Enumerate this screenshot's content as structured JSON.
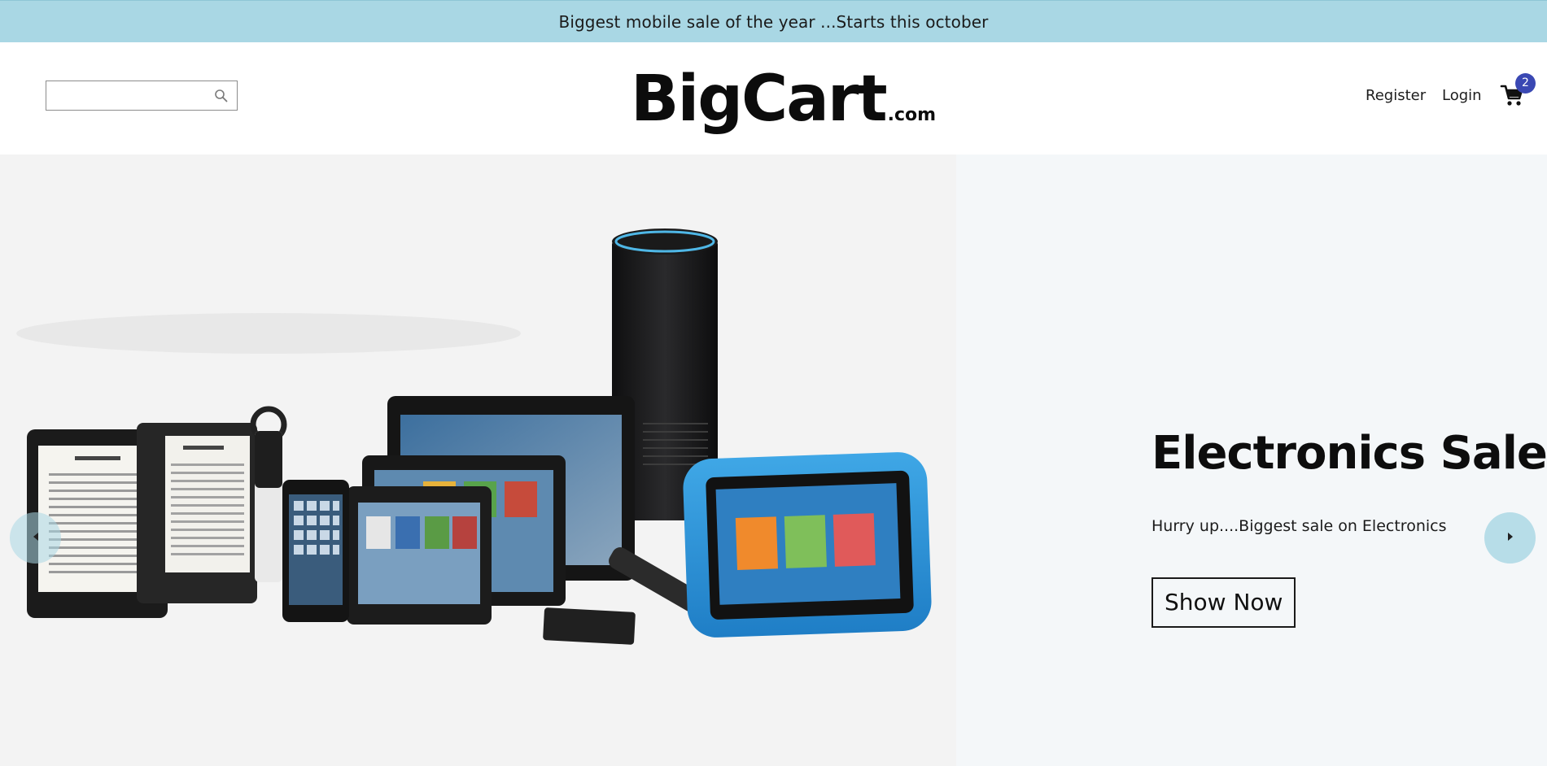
{
  "announcement": {
    "text": "Biggest mobile sale of the year ...Starts this october"
  },
  "header": {
    "search": {
      "value": "",
      "placeholder": "",
      "icon": "search-icon"
    },
    "logo": {
      "main": "BigCart",
      "tld": ".com"
    },
    "nav": {
      "register_label": "Register",
      "login_label": "Login"
    },
    "cart": {
      "icon": "cart-icon",
      "count": "2",
      "badge_color": "#3a48b3"
    }
  },
  "hero": {
    "title": "Electronics Sale",
    "subtitle": "Hurry up....Biggest sale on Electronics",
    "cta_label": "Show Now",
    "prev_icon": "chevron-left-icon",
    "next_icon": "chevron-right-icon"
  },
  "colors": {
    "announcement_bg": "#a9d7e4",
    "hero_bg": "#f4f7f9",
    "accent": "#3a48b3"
  }
}
